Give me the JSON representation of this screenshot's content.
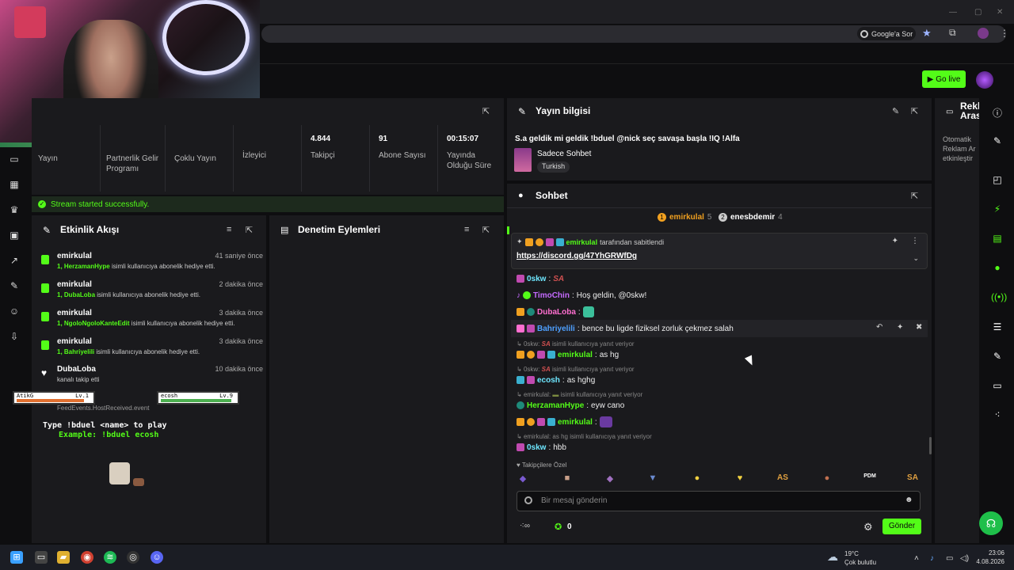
{
  "browser": {
    "google_chip": "Google'a Sor",
    "go_live": "Go live"
  },
  "stats": [
    {
      "value": "",
      "label": "Yayın"
    },
    {
      "value": "",
      "label": "Partnerlik Gelir Programı"
    },
    {
      "value": "",
      "label": "Çoklu Yayın"
    },
    {
      "value": "",
      "label": "İzleyici"
    },
    {
      "value": "4.844",
      "label": "Takipçi"
    },
    {
      "value": "91",
      "label": "Abone Sayısı"
    },
    {
      "value": "00:15:07",
      "label": "Yayında Olduğu Süre"
    }
  ],
  "banner": "Stream started successfully.",
  "feed": {
    "title": "Etkinlik Akışı",
    "items": [
      {
        "name": "emirkulal",
        "time": "41 saniye önce",
        "count": "1,",
        "target": "HerzamanHype",
        "desc": "isimli kullanıcıya abonelik hediye etti."
      },
      {
        "name": "emirkulal",
        "time": "2 dakika önce",
        "count": "1,",
        "target": "DubaLoba",
        "desc": "isimli kullanıcıya abonelik hediye etti."
      },
      {
        "name": "emirkulal",
        "time": "3 dakika önce",
        "count": "1,",
        "target": "NgoloNgoloKanteEdit",
        "desc": "isimli kullanıcıya abonelik hediye etti."
      },
      {
        "name": "emirkulal",
        "time": "3 dakika önce",
        "count": "1,",
        "target": "Bahriyelili",
        "desc": "isimli kullanıcıya abonelik hediye etti."
      },
      {
        "name": "DubaLoba",
        "time": "10 dakika önce",
        "count": "",
        "target": "",
        "desc": "kanalı takip etti"
      }
    ],
    "partial_event": "FeedEvents.HostReceived.event",
    "game": {
      "p1_name": "AtikG",
      "p1_lv": "Lv.1",
      "p1_hp": 0.9,
      "p2_name": "ecosh",
      "p2_lv": "Lv.9",
      "p2_hp": 0.95,
      "line1": "Type !bduel <name> to play",
      "line2": "Example: !bduel ecosh"
    }
  },
  "denetim": {
    "title": "Denetim Eylemleri"
  },
  "yayin": {
    "title": "Yayın bilgisi",
    "stream_title": "S.a geldik mi geldik !bduel @nick seç savaşa başla !IQ !Alfa",
    "category": "Sadece Sohbet",
    "tag": "Turkish"
  },
  "sohbet": {
    "title": "Sohbet",
    "top1": {
      "rank": "1",
      "name": "emirkulal",
      "count": "5"
    },
    "top2": {
      "rank": "2",
      "name": "enesbdemir",
      "count": "4"
    },
    "pinned_by": "emirkulal",
    "pinned_suffix": "tarafından sabitlendi",
    "pinned_link": "https://discord.gg/47YhGRWfDg",
    "messages": [
      {
        "user": "0skw",
        "color": "#6ee7ff",
        "text": "SA",
        "sep": ":"
      },
      {
        "user": "TimoChin",
        "color": "#c56bff",
        "text": "Hoş geldin, @0skw!",
        "sep": ":"
      },
      {
        "user": "DubaLoba",
        "color": "#ff6fd0",
        "text": "",
        "sep": ":"
      },
      {
        "user": "Bahriyelili",
        "color": "#4ea0ff",
        "text": "bence bu ligde fiziksel zorluk çekmez salah",
        "sep": ":"
      },
      {
        "user": "emirkulal",
        "color": "#53fc18",
        "text": "as hg",
        "sep": ":"
      },
      {
        "user": "ecosh",
        "color": "#6ee7ff",
        "text": "as hghg",
        "sep": ":"
      },
      {
        "user": "HerzamanHype",
        "color": "#53fc18",
        "text": "eyw cano",
        "sep": ":"
      },
      {
        "user": "emirkulal",
        "color": "#53fc18",
        "text": "",
        "sep": ":"
      },
      {
        "user": "0skw",
        "color": "#6ee7ff",
        "text": "hbb",
        "sep": ":"
      }
    ],
    "replies": [
      {
        "who": "0skw:",
        "emote": "SA",
        "rest": "isimli kullanıcıya yanıt veriyor"
      },
      {
        "who": "0skw:",
        "emote": "SA",
        "rest": "isimli kullanıcıya yanıt veriyor"
      },
      {
        "who": "emirkulal:",
        "emote": "",
        "rest": "isimli kullanıcıya yanıt veriyor"
      },
      {
        "who": "emirkulal: as hg",
        "emote": "",
        "rest": "isimli kullanıcıya yanıt veriyor"
      }
    ],
    "emote_bar_label": "Takipçilere Özel",
    "input_placeholder": "Bir mesaj gönderin",
    "points": "0",
    "send": "Gönder"
  },
  "reklam": {
    "title": "Rekl Aras",
    "desc": "Otomatik Reklam Ar etkinleştir"
  },
  "taskbar": {
    "weather_temp": "19°C",
    "weather_desc": "Çok bulutlu",
    "time": "23:06",
    "date": "4.08.2026"
  }
}
